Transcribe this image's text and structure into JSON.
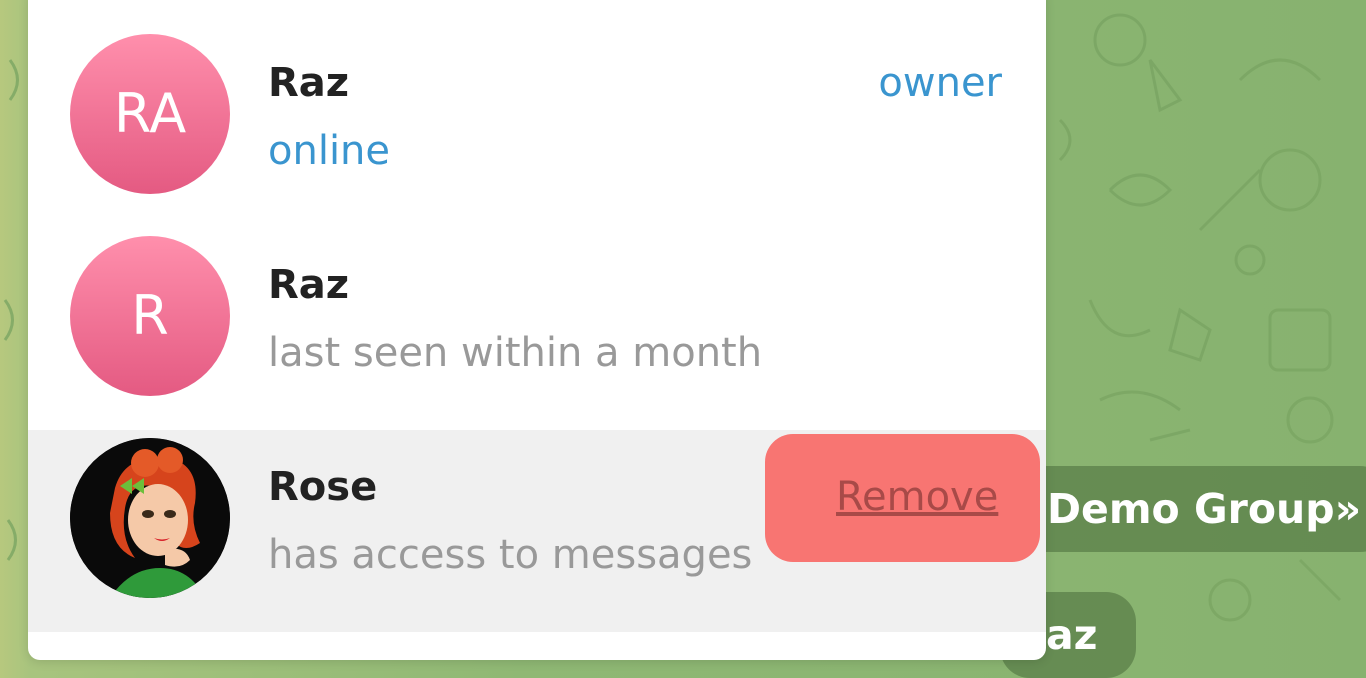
{
  "members": [
    {
      "initials": "RA",
      "name": "Raz",
      "status": "online",
      "role": "owner"
    },
    {
      "initials": "R",
      "name": "Raz",
      "status": "last seen within a month"
    },
    {
      "name": "Rose",
      "status": "has access to messages",
      "action": "Remove"
    }
  ],
  "background_messages": {
    "group_text": "Demo Group»",
    "sender_fragment": "az"
  },
  "colors": {
    "accent": "#3a95cf",
    "avatar_gradient_top": "#ff8fac",
    "avatar_gradient_bottom": "#e45a82",
    "remove_highlight": "#f87572",
    "chat_background": "#8fb874"
  },
  "icons": [
    "rose-avatar-image"
  ]
}
